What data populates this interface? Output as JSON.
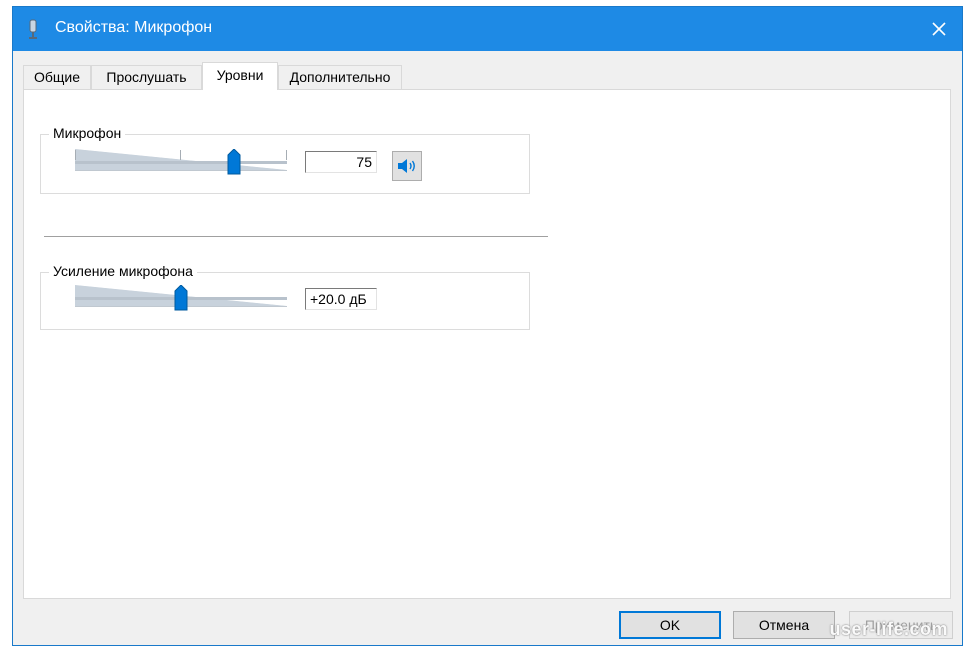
{
  "window": {
    "title": "Свойства: Микрофон",
    "title_icon": "microphone-icon",
    "close_icon": "close-icon"
  },
  "tabs": [
    {
      "label": "Общие",
      "active": false
    },
    {
      "label": "Прослушать",
      "active": false
    },
    {
      "label": "Уровни",
      "active": true
    },
    {
      "label": "Дополнительно",
      "active": false
    }
  ],
  "levels": {
    "microphone": {
      "label": "Микрофон",
      "value": "75",
      "level_percent": 75,
      "mute_button_icon": "speaker-icon"
    },
    "boost": {
      "label": "Усиление микрофона",
      "value": "+20.0 дБ",
      "level_fraction": 0.5
    }
  },
  "buttons": {
    "ok": "OK",
    "cancel": "Отмена",
    "apply": "Применить"
  },
  "watermark": "user-life.com",
  "colors": {
    "titlebar": "#1e8ae5",
    "accent": "#0078d7"
  }
}
